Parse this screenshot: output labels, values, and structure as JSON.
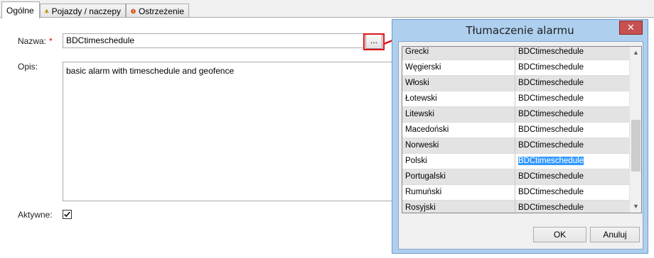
{
  "tabs": [
    {
      "label": "Ogólne",
      "icon": "none"
    },
    {
      "label": "Pojazdy / naczepy",
      "icon": "warning-icon"
    },
    {
      "label": "Ostrzeżenie",
      "icon": "stop-icon"
    }
  ],
  "form": {
    "name_label": "Nazwa:",
    "required_mark": "*",
    "name_value": "BDCtimeschedule",
    "more_button": "...",
    "desc_label": "Opis:",
    "desc_value": "basic alarm with timeschedule and geofence",
    "active_label": "Aktywne:",
    "active_checked": true
  },
  "dialog": {
    "title": "Tłumaczenie alarmu",
    "close_label": "✕",
    "rows": [
      {
        "lang": "Grecki",
        "text": "BDCtimeschedule"
      },
      {
        "lang": "Węgierski",
        "text": "BDCtimeschedule"
      },
      {
        "lang": "Włoski",
        "text": "BDCtimeschedule"
      },
      {
        "lang": "Łotewski",
        "text": "BDCtimeschedule"
      },
      {
        "lang": "Litewski",
        "text": "BDCtimeschedule"
      },
      {
        "lang": "Macedoński",
        "text": "BDCtimeschedule"
      },
      {
        "lang": "Norweski",
        "text": "BDCtimeschedule"
      },
      {
        "lang": "Polski",
        "text": "BDCtimeschedule"
      },
      {
        "lang": "Portugalski",
        "text": "BDCtimeschedule"
      },
      {
        "lang": "Rumuński",
        "text": "BDCtimeschedule"
      },
      {
        "lang": "Rosyjski",
        "text": "BDCtimeschedule"
      }
    ],
    "selected_row": "Polski",
    "ok_label": "OK",
    "cancel_label": "Anuluj"
  },
  "colors": {
    "highlight_red": "#e2121b",
    "selection_blue": "#3399ff",
    "dialog_frame": "#aecfee"
  }
}
